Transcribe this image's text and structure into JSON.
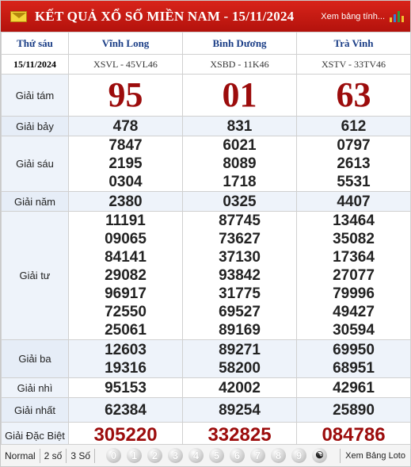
{
  "header": {
    "title": "KẾT QUẢ XỔ SỐ MIỀN NAM - 15/11/2024",
    "view_full": "Xem bảng tính...",
    "email_icon": "envelope-icon",
    "chart_icon": "bar-chart-icon"
  },
  "table": {
    "day": "Thứ sáu",
    "date": "15/11/2024",
    "provinces": [
      "Vĩnh Long",
      "Bình Dương",
      "Trà Vinh"
    ],
    "codes": [
      "XSVL - 45VL46",
      "XSBD - 11K46",
      "XSTV - 33TV46"
    ],
    "rows": [
      {
        "label": "Giải tám",
        "values": [
          [
            "95"
          ],
          [
            "01"
          ],
          [
            "63"
          ]
        ]
      },
      {
        "label": "Giải bảy",
        "values": [
          [
            "478"
          ],
          [
            "831"
          ],
          [
            "612"
          ]
        ]
      },
      {
        "label": "Giải sáu",
        "values": [
          [
            "7847",
            "2195",
            "0304"
          ],
          [
            "6021",
            "8089",
            "1718"
          ],
          [
            "0797",
            "2613",
            "5531"
          ]
        ]
      },
      {
        "label": "Giải năm",
        "values": [
          [
            "2380"
          ],
          [
            "0325"
          ],
          [
            "4407"
          ]
        ]
      },
      {
        "label": "Giải tư",
        "values": [
          [
            "11191",
            "09065",
            "84141",
            "29082",
            "96917",
            "72550",
            "25061"
          ],
          [
            "87745",
            "73627",
            "37130",
            "93842",
            "31775",
            "69527",
            "89169"
          ],
          [
            "13464",
            "35082",
            "17364",
            "27077",
            "79996",
            "49427",
            "30594"
          ]
        ]
      },
      {
        "label": "Giải ba",
        "values": [
          [
            "12603",
            "19316"
          ],
          [
            "89271",
            "58200"
          ],
          [
            "69950",
            "68951"
          ]
        ]
      },
      {
        "label": "Giải nhì",
        "values": [
          [
            "95153"
          ],
          [
            "42002"
          ],
          [
            "42961"
          ]
        ]
      },
      {
        "label": "Giải nhất",
        "values": [
          [
            "62384"
          ],
          [
            "89254"
          ],
          [
            "25890"
          ]
        ]
      },
      {
        "label": "Giải Đặc Biệt",
        "values": [
          [
            "305220"
          ],
          [
            "332825"
          ],
          [
            "084786"
          ]
        ]
      }
    ]
  },
  "footer": {
    "tabs": [
      "Normal",
      "2 số",
      "3 Số"
    ],
    "digits": [
      "0",
      "1",
      "2",
      "3",
      "4",
      "5",
      "6",
      "7",
      "8",
      "9"
    ],
    "all_icon": "yin-yang-icon",
    "loto_link": "Xem Bảng Loto"
  },
  "colors": {
    "header_red": "#c41a12",
    "prize_red": "#9c0c0c",
    "province_blue": "#1a3d86"
  }
}
